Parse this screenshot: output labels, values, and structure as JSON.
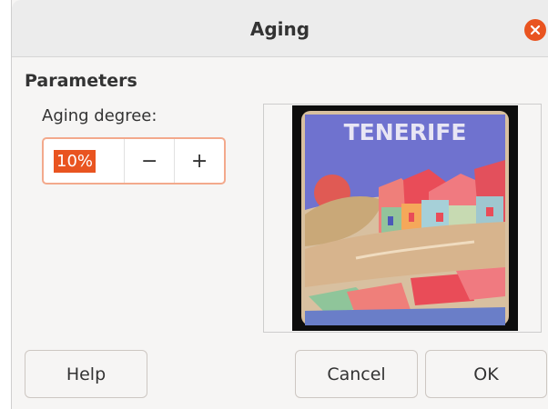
{
  "dialog": {
    "title": "Aging",
    "close_icon": "close-icon"
  },
  "parameters": {
    "section_title": "Parameters",
    "aging_label": "Aging degree:",
    "aging_value": "10%",
    "decrement_symbol": "−",
    "increment_symbol": "+"
  },
  "preview": {
    "tile_text": "TENERIFE"
  },
  "buttons": {
    "help": "Help",
    "cancel": "Cancel",
    "ok": "OK"
  },
  "colors": {
    "accent": "#e95420",
    "focus_border": "#f3a98c"
  }
}
